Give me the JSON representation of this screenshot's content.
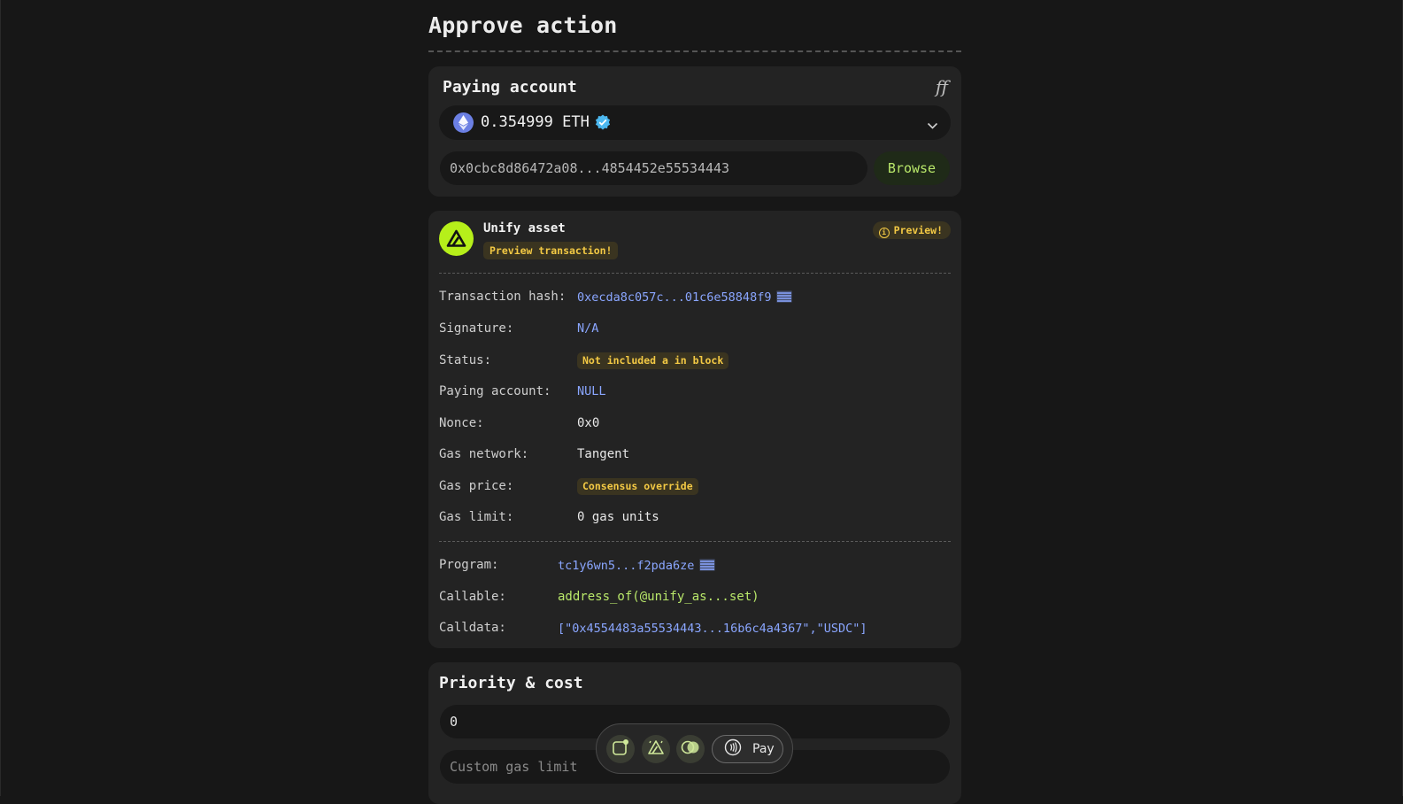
{
  "page": {
    "title": "Approve action"
  },
  "paying_account": {
    "title": "Paying account",
    "settings_glyph": "ff",
    "balance": "0.354999 ETH",
    "address": "0x0cbc8d86472a08...4854452e55534443",
    "browse_label": "Browse"
  },
  "transaction": {
    "app_name": "Unify asset",
    "preview_tx_label": "Preview transaction!",
    "preview_badge": "Preview!",
    "fields": {
      "hash_label": "Transaction hash:",
      "hash_value": "0xecda8c057c...01c6e58848f9",
      "signature_label": "Signature:",
      "signature_value": "N/A",
      "status_label": "Status:",
      "status_value": "Not included a in block",
      "paying_label": "Paying account:",
      "paying_value": "NULL",
      "nonce_label": "Nonce:",
      "nonce_value": "0x0",
      "network_label": "Gas network:",
      "network_value": "Tangent",
      "price_label": "Gas price:",
      "price_value": "Consensus override",
      "limit_label": "Gas limit:",
      "limit_value": "0 gas units"
    },
    "call": {
      "program_label": "Program:",
      "program_value": "tc1y6wn5...f2pda6ze",
      "callable_label": "Callable:",
      "callable_value": "address_of(@unify_as...set)",
      "calldata_label": "Calldata:",
      "calldata_value": "[\"0x4554483a55534443...16b6c4a4367\",\"USDC\"]"
    }
  },
  "priority": {
    "title": "Priority & cost",
    "priority_value": "0",
    "gas_limit_placeholder": "Custom gas limit"
  },
  "toolbar": {
    "pay_label": "Pay"
  },
  "colors": {
    "accent_green": "#b6ef1a",
    "link_blue": "#8aa6ff",
    "warn_yellow": "#f3c944"
  }
}
